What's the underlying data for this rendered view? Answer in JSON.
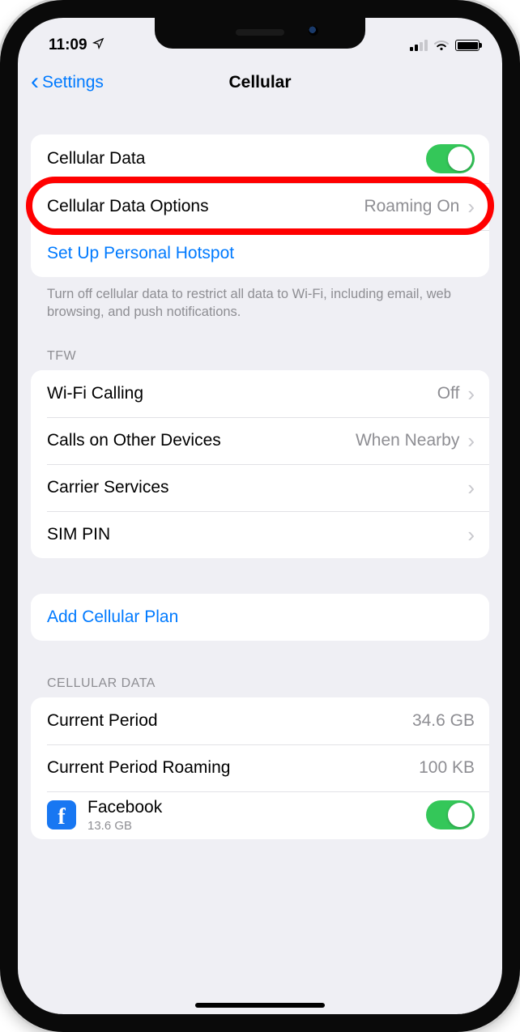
{
  "status": {
    "time": "11:09"
  },
  "nav": {
    "back": "Settings",
    "title": "Cellular"
  },
  "group1": {
    "cellular_data": "Cellular Data",
    "options_label": "Cellular Data Options",
    "options_value": "Roaming On",
    "hotspot": "Set Up Personal Hotspot",
    "footer": "Turn off cellular data to restrict all data to Wi-Fi, including email, web browsing, and push notifications."
  },
  "group2": {
    "header": "TFW",
    "wifi_calling_label": "Wi-Fi Calling",
    "wifi_calling_value": "Off",
    "calls_other_label": "Calls on Other Devices",
    "calls_other_value": "When Nearby",
    "carrier_services": "Carrier Services",
    "sim_pin": "SIM PIN"
  },
  "group3": {
    "add_plan": "Add Cellular Plan"
  },
  "group4": {
    "header": "CELLULAR DATA",
    "current_period_label": "Current Period",
    "current_period_value": "34.6 GB",
    "roaming_label": "Current Period Roaming",
    "roaming_value": "100 KB",
    "app_name": "Facebook",
    "app_usage": "13.6 GB"
  }
}
